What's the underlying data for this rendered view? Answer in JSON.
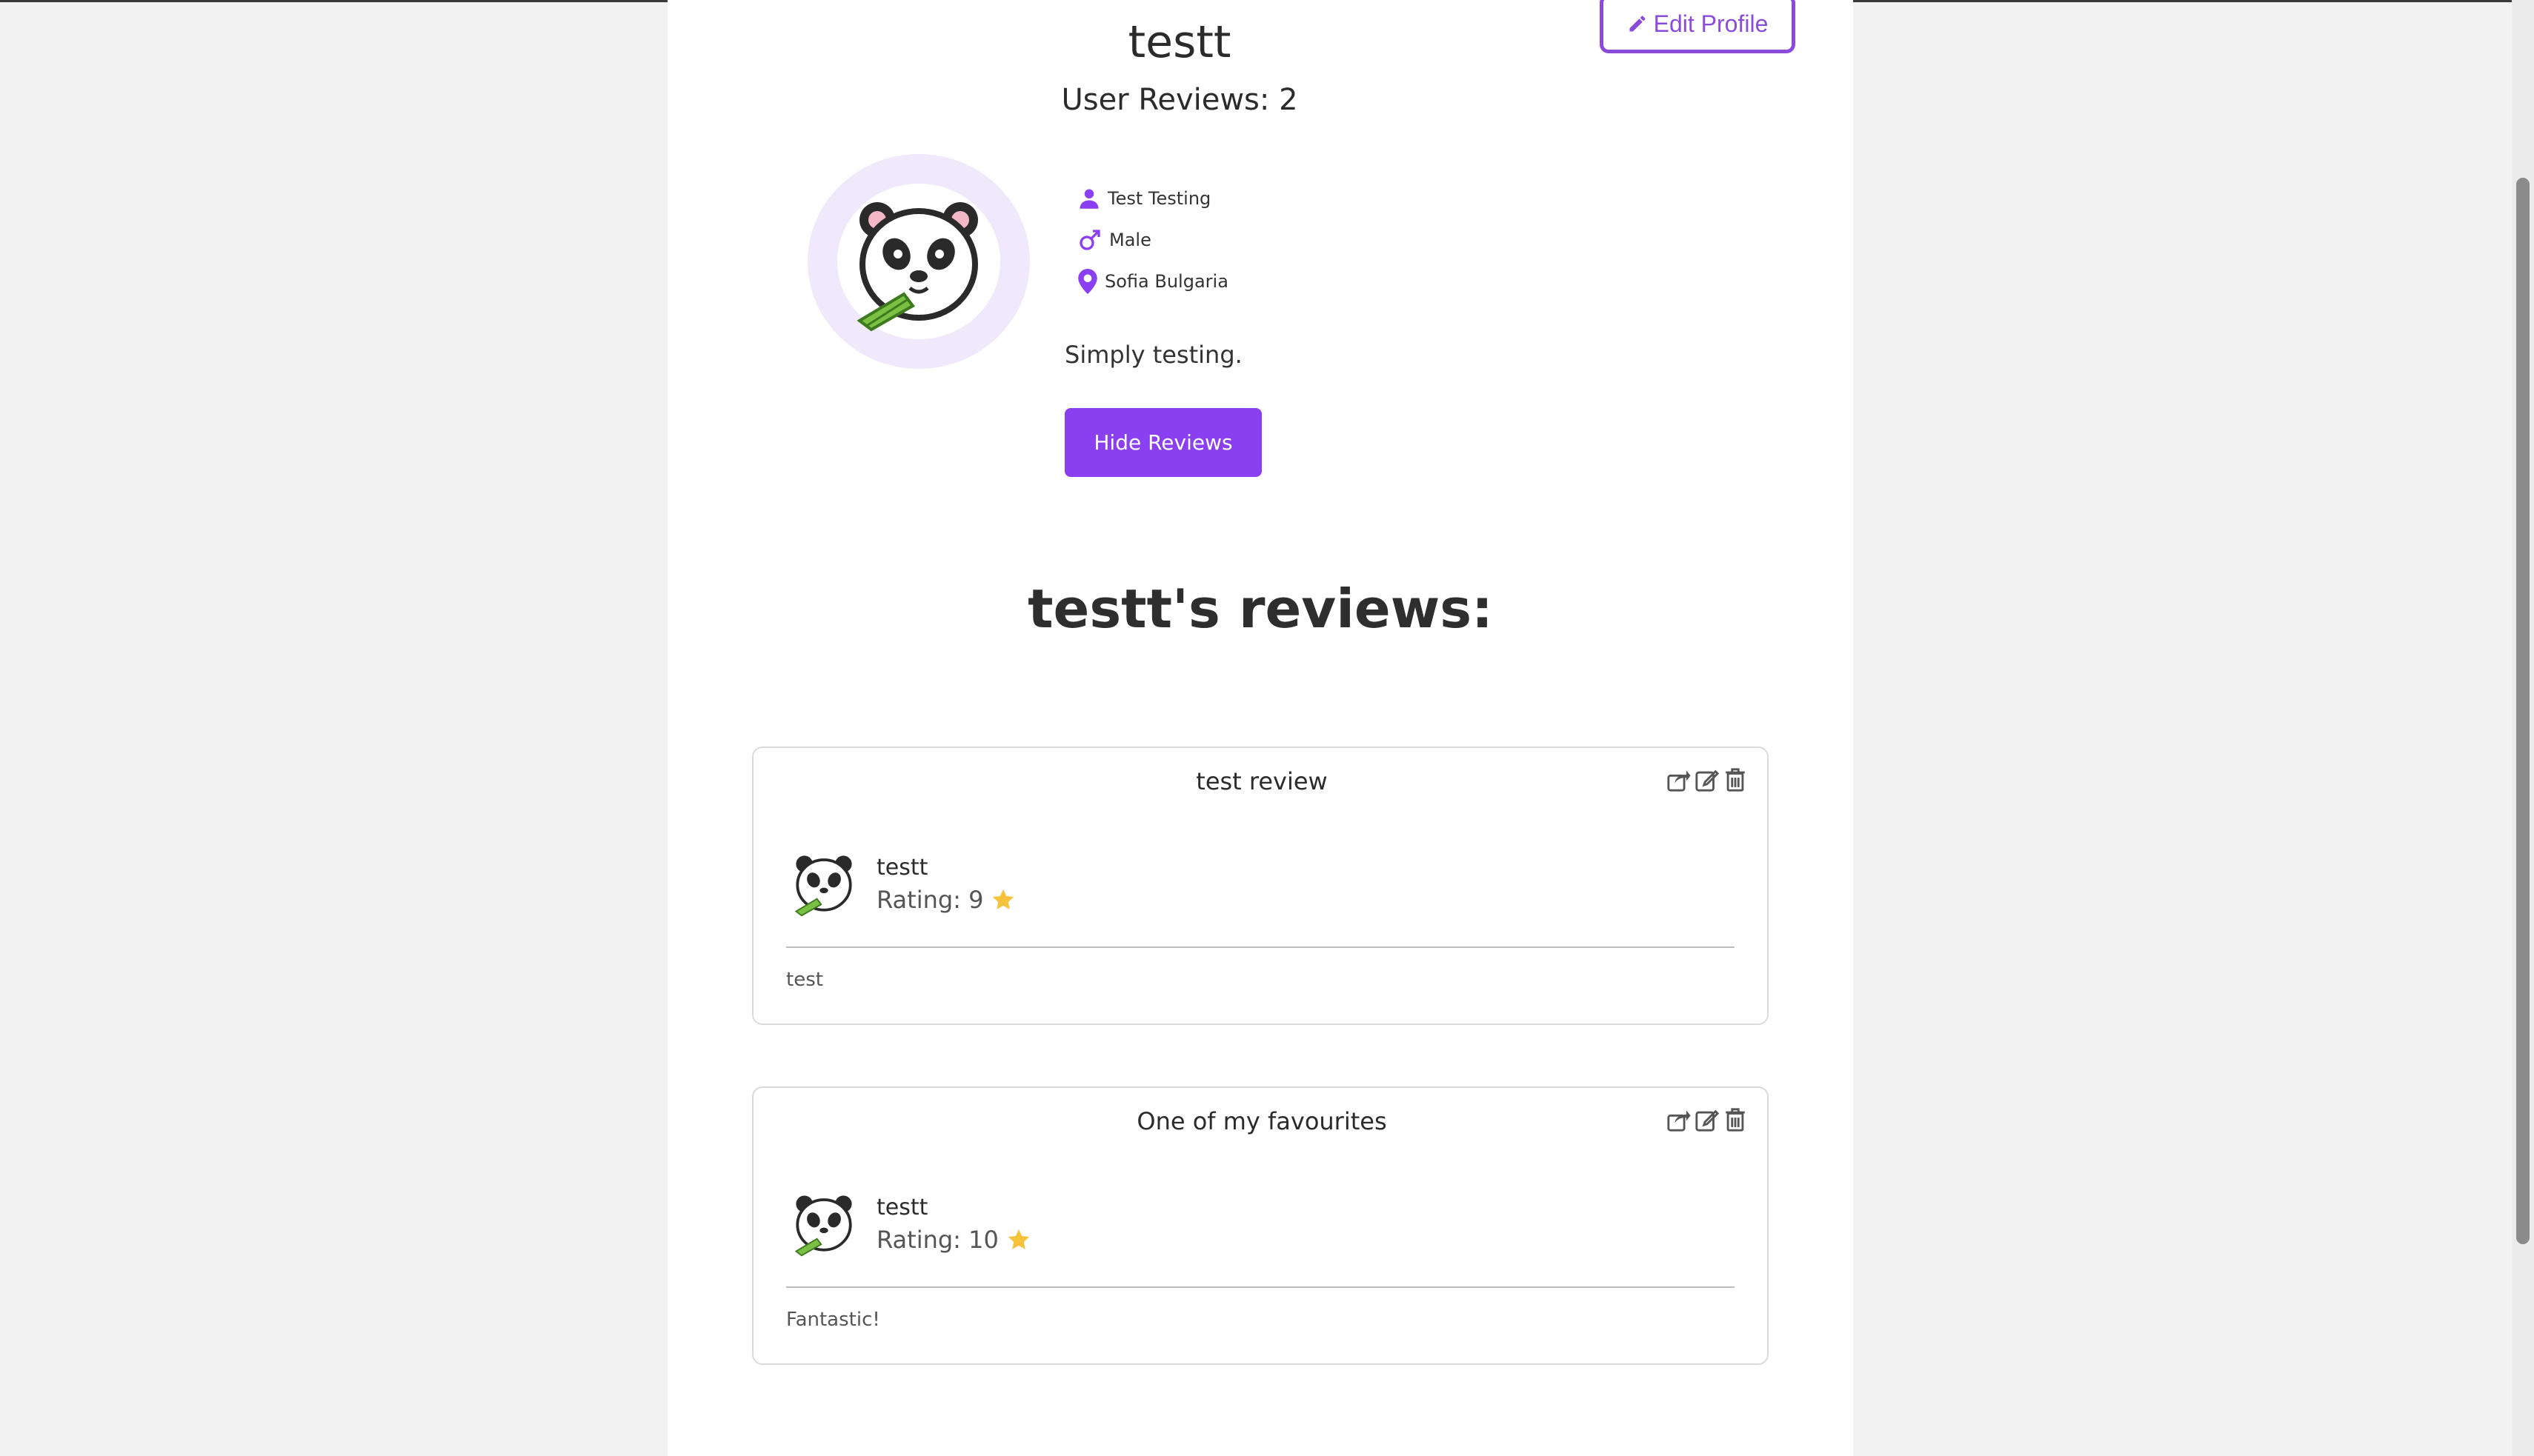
{
  "profile": {
    "username": "testt",
    "reviews_label": "User Reviews: 2",
    "edit_label": "Edit Profile",
    "full_name": "Test Testing",
    "gender": "Male",
    "location": "Sofia Bulgaria",
    "bio": "Simply testing.",
    "hide_reviews_label": "Hide Reviews"
  },
  "reviews_section": {
    "title": "testt's reviews:",
    "reviews": [
      {
        "title": "test review",
        "author": "testt",
        "rating_label": "Rating: 9",
        "text": "test"
      },
      {
        "title": "One of my favourites",
        "author": "testt",
        "rating_label": "Rating: 10",
        "text": "Fantastic!"
      }
    ]
  },
  "colors": {
    "accent": "#8a3ff0",
    "star": "#f5c33b"
  },
  "icons": [
    "pencil-icon",
    "user-icon",
    "male-icon",
    "location-pin-icon",
    "share-icon",
    "edit-icon",
    "trash-icon",
    "star-icon",
    "panda-avatar"
  ]
}
